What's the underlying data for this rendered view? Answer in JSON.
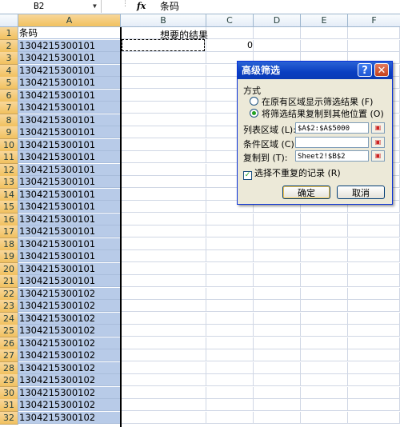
{
  "formula_bar": {
    "name_box": "B2",
    "fx_label": "fx",
    "formula": "条码"
  },
  "columns": [
    "A",
    "B",
    "C",
    "D",
    "E",
    "F"
  ],
  "cells": {
    "A1": "条码",
    "B1": "想要的结果",
    "C2": "0"
  },
  "rows": [
    {
      "n": "1",
      "a": "条码"
    },
    {
      "n": "2",
      "a": "1304215300101"
    },
    {
      "n": "3",
      "a": "1304215300101"
    },
    {
      "n": "4",
      "a": "1304215300101"
    },
    {
      "n": "5",
      "a": "1304215300101"
    },
    {
      "n": "6",
      "a": "1304215300101"
    },
    {
      "n": "7",
      "a": "1304215300101"
    },
    {
      "n": "8",
      "a": "1304215300101"
    },
    {
      "n": "9",
      "a": "1304215300101"
    },
    {
      "n": "10",
      "a": "1304215300101"
    },
    {
      "n": "11",
      "a": "1304215300101"
    },
    {
      "n": "12",
      "a": "1304215300101"
    },
    {
      "n": "13",
      "a": "1304215300101"
    },
    {
      "n": "14",
      "a": "1304215300101"
    },
    {
      "n": "15",
      "a": "1304215300101"
    },
    {
      "n": "16",
      "a": "1304215300101"
    },
    {
      "n": "17",
      "a": "1304215300101"
    },
    {
      "n": "18",
      "a": "1304215300101"
    },
    {
      "n": "19",
      "a": "1304215300101"
    },
    {
      "n": "20",
      "a": "1304215300101"
    },
    {
      "n": "21",
      "a": "1304215300101"
    },
    {
      "n": "22",
      "a": "1304215300102"
    },
    {
      "n": "23",
      "a": "1304215300102"
    },
    {
      "n": "24",
      "a": "1304215300102"
    },
    {
      "n": "25",
      "a": "1304215300102"
    },
    {
      "n": "26",
      "a": "1304215300102"
    },
    {
      "n": "27",
      "a": "1304215300102"
    },
    {
      "n": "28",
      "a": "1304215300102"
    },
    {
      "n": "29",
      "a": "1304215300102"
    },
    {
      "n": "30",
      "a": "1304215300102"
    },
    {
      "n": "31",
      "a": "1304215300102"
    },
    {
      "n": "32",
      "a": "1304215300102"
    }
  ],
  "dialog": {
    "title": "高级筛选",
    "help": "?",
    "close": "✕",
    "method_label": "方式",
    "option1": "在原有区域显示筛选结果 (F)",
    "option2": "将筛选结果复制到其他位置 (O)",
    "list_range_label": "列表区域 (L):",
    "list_range_value": "$A$2:$A$5000",
    "criteria_label": "条件区域 (C):",
    "criteria_value": "",
    "copy_to_label": "复制到 (T):",
    "copy_to_value": "Sheet2!$B$2",
    "unique_label": "选择不重复的记录 (R)",
    "ok": "确定",
    "cancel": "取消"
  },
  "colors": {
    "selection": "#b8cbe8",
    "header_selected": "#f1c15f",
    "title_bar": "#0a3fc1"
  }
}
